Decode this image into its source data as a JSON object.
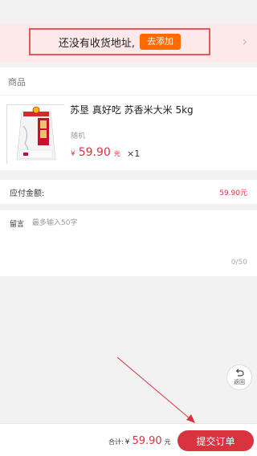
{
  "address": {
    "prompt": "还没有收货地址,",
    "add_label": "去添加",
    "arrow": "›"
  },
  "goods": {
    "section_title": "商品",
    "item": {
      "name": "苏垦 真好吃 苏香米大米 5kg",
      "spec": "随机",
      "currency": "¥",
      "price": "59.90",
      "price_unit": "元",
      "quantity": "×1"
    }
  },
  "payable": {
    "label": "应付金额:",
    "value": "59.90元"
  },
  "message": {
    "label": "留言",
    "placeholder": "最多输入50字",
    "counter": "0/50"
  },
  "floating": {
    "back_label": "返回",
    "back_icon": "return-arrow-icon"
  },
  "bottom_bar": {
    "total_label": "合计:",
    "currency": "¥",
    "amount": "59.90",
    "unit": "元",
    "submit_label": "提交订单"
  },
  "colors": {
    "accent_red": "#d9333f",
    "orange": "#ff6a00",
    "banner_pink": "#fde8ea",
    "highlight_red": "#e2565c"
  }
}
